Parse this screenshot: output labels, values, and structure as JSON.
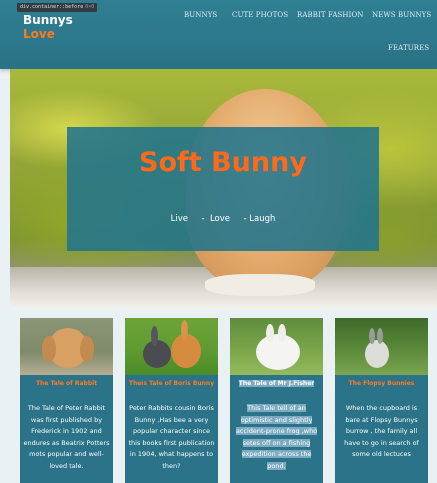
{
  "devtools_tip": {
    "selector": "div.container::before",
    "size": "0×0"
  },
  "brand": {
    "line1": "Bunnys",
    "line2": "Love"
  },
  "nav": {
    "items": [
      {
        "label": "BUNNYS"
      },
      {
        "label": "CUTE PHOTOS"
      },
      {
        "label": "RABBIT FASHION"
      },
      {
        "label": "NEWS BUNNYS"
      },
      {
        "label": "FEATURES"
      }
    ]
  },
  "hero": {
    "title": "Soft Bunny",
    "tagline": "Live     -  Love     - Laugh"
  },
  "cards": [
    {
      "title": "The Tale of Rabbit",
      "description": "The Tale of Peter Rabbit was first published by Frederick in 1902 and endures as Beatrix Potters mots popular and well-loved tale."
    },
    {
      "title": "Theis Tale of Boris Bunny",
      "description": "Peter Rabbits cousin Boris Bunny ,Has bee a very popular character since this books first publication in 1904, what happens to then?"
    },
    {
      "title": "The Tale of Mr J.Fisher",
      "description": "This Tale tell of an optimistic and slightly accident-prone frog ,who setes off on a fishing expedition across the pond."
    },
    {
      "title": "The Flopsy Bunnies",
      "description": "When the cupboard is bare at Flopsy Bunnys burrow , the family all have to go in search of some old lectuces"
    }
  ],
  "colors": {
    "header_bg": "#2f7f93",
    "accent_orange": "#ff6a1a",
    "card_bg": "#2b7388",
    "hero_overlay": "#22748c"
  }
}
